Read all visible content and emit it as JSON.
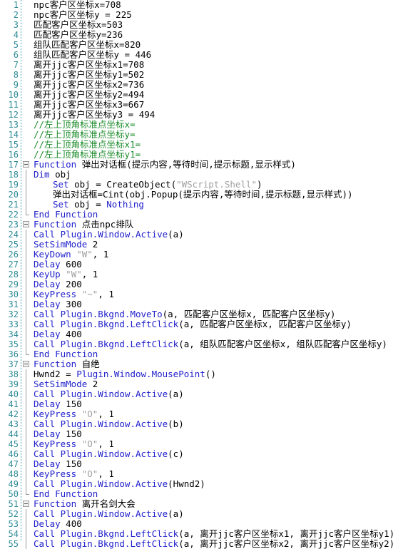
{
  "editor": {
    "name": "vbs-script-editor",
    "language": "VBScript / 按键精灵",
    "colors": {
      "background": "#ffffff",
      "line_number": "#2e8b96",
      "gutter_separator": "#4aa3b0",
      "keyword": "#2222cc",
      "comment": "#1b8b2a",
      "string": "#a0a0a0",
      "text": "#000000",
      "fold_marker": "#9a9a9a"
    },
    "first_visible_line": 1,
    "last_visible_line": 55,
    "total_visible_lines": 55
  },
  "lines": [
    {
      "n": 1,
      "fold": "none",
      "indent": 1,
      "tokens": [
        {
          "t": "plain",
          "s": "npc客户区坐标x=708"
        }
      ]
    },
    {
      "n": 2,
      "fold": "none",
      "indent": 1,
      "tokens": [
        {
          "t": "plain",
          "s": "npc客户区坐标y = 225"
        }
      ]
    },
    {
      "n": 3,
      "fold": "none",
      "indent": 1,
      "tokens": [
        {
          "t": "plain",
          "s": "匹配客户区坐标x=503"
        }
      ]
    },
    {
      "n": 4,
      "fold": "none",
      "indent": 1,
      "tokens": [
        {
          "t": "plain",
          "s": "匹配客户区坐标y=236"
        }
      ]
    },
    {
      "n": 5,
      "fold": "none",
      "indent": 1,
      "tokens": [
        {
          "t": "plain",
          "s": "组队匹配客户区坐标x=820"
        }
      ]
    },
    {
      "n": 6,
      "fold": "none",
      "indent": 1,
      "tokens": [
        {
          "t": "plain",
          "s": "组队匹配客户区坐标y = 446"
        }
      ]
    },
    {
      "n": 7,
      "fold": "none",
      "indent": 1,
      "tokens": [
        {
          "t": "plain",
          "s": "离开jjc客户区坐标x1=708"
        }
      ]
    },
    {
      "n": 8,
      "fold": "none",
      "indent": 1,
      "tokens": [
        {
          "t": "plain",
          "s": "离开jjc客户区坐标y1=502"
        }
      ]
    },
    {
      "n": 9,
      "fold": "none",
      "indent": 1,
      "tokens": [
        {
          "t": "plain",
          "s": "离开jjc客户区坐标x2=736"
        }
      ]
    },
    {
      "n": 10,
      "fold": "none",
      "indent": 1,
      "tokens": [
        {
          "t": "plain",
          "s": "离开jjc客户区坐标y2=494"
        }
      ]
    },
    {
      "n": 11,
      "fold": "none",
      "indent": 1,
      "tokens": [
        {
          "t": "plain",
          "s": "离开jjc客户区坐标x3=667"
        }
      ]
    },
    {
      "n": 12,
      "fold": "none",
      "indent": 1,
      "tokens": [
        {
          "t": "plain",
          "s": "离开jjc客户区坐标y3 = 494"
        }
      ]
    },
    {
      "n": 13,
      "fold": "none",
      "indent": 1,
      "tokens": [
        {
          "t": "cmt",
          "s": "//左上顶角标准点坐标x="
        }
      ]
    },
    {
      "n": 14,
      "fold": "none",
      "indent": 1,
      "tokens": [
        {
          "t": "cmt",
          "s": "//左上顶角标准点坐标y="
        }
      ]
    },
    {
      "n": 15,
      "fold": "none",
      "indent": 1,
      "tokens": [
        {
          "t": "cmt",
          "s": "//左上顶角标准点坐标x1="
        }
      ]
    },
    {
      "n": 16,
      "fold": "none",
      "indent": 1,
      "tokens": [
        {
          "t": "cmt",
          "s": "//左上顶角标准点坐标y1="
        }
      ]
    },
    {
      "n": 17,
      "fold": "start",
      "indent": 0,
      "tokens": [
        {
          "t": "kw",
          "s": "Function"
        },
        {
          "t": "plain",
          "s": " 弹出对话框(提示内容,等待时间,提示标题,显示样式)"
        }
      ]
    },
    {
      "n": 18,
      "fold": "mid",
      "indent": 0,
      "tokens": [
        {
          "t": "kw",
          "s": "Dim"
        },
        {
          "t": "plain",
          "s": " obj"
        }
      ]
    },
    {
      "n": 19,
      "fold": "mid",
      "indent": 2,
      "tokens": [
        {
          "t": "kw",
          "s": "Set"
        },
        {
          "t": "plain",
          "s": " obj = CreateObject("
        },
        {
          "t": "str",
          "s": "\"WScript.Shell\""
        },
        {
          "t": "plain",
          "s": ")"
        }
      ]
    },
    {
      "n": 20,
      "fold": "mid",
      "indent": 2,
      "tokens": [
        {
          "t": "plain",
          "s": "弹出对话框=Cint(obj.Popup(提示内容,等待时间,提示标题,显示样式))"
        }
      ]
    },
    {
      "n": 21,
      "fold": "mid",
      "indent": 2,
      "tokens": [
        {
          "t": "kw",
          "s": "Set"
        },
        {
          "t": "plain",
          "s": " obj = "
        },
        {
          "t": "kw",
          "s": "Nothing"
        }
      ]
    },
    {
      "n": 22,
      "fold": "end",
      "indent": 0,
      "tokens": [
        {
          "t": "kw",
          "s": "End Function"
        }
      ]
    },
    {
      "n": 23,
      "fold": "start",
      "indent": 0,
      "tokens": [
        {
          "t": "kw",
          "s": "Function"
        },
        {
          "t": "plain",
          "s": " 点击npc排队"
        }
      ]
    },
    {
      "n": 24,
      "fold": "mid",
      "indent": 0,
      "tokens": [
        {
          "t": "kw",
          "s": "Call Plugin.Window.Active"
        },
        {
          "t": "plain",
          "s": "(a)"
        }
      ]
    },
    {
      "n": 25,
      "fold": "mid",
      "indent": 0,
      "tokens": [
        {
          "t": "kw",
          "s": "SetSimMode"
        },
        {
          "t": "plain",
          "s": " 2"
        }
      ]
    },
    {
      "n": 26,
      "fold": "mid",
      "indent": 0,
      "tokens": [
        {
          "t": "kw",
          "s": "KeyDown"
        },
        {
          "t": "plain",
          "s": " "
        },
        {
          "t": "str",
          "s": "\"W\""
        },
        {
          "t": "plain",
          "s": ", 1"
        }
      ]
    },
    {
      "n": 27,
      "fold": "mid",
      "indent": 0,
      "tokens": [
        {
          "t": "kw",
          "s": "Delay"
        },
        {
          "t": "plain",
          "s": " 600"
        }
      ]
    },
    {
      "n": 28,
      "fold": "mid",
      "indent": 0,
      "tokens": [
        {
          "t": "kw",
          "s": "KeyUp"
        },
        {
          "t": "plain",
          "s": " "
        },
        {
          "t": "str",
          "s": "\"W\""
        },
        {
          "t": "plain",
          "s": ", 1"
        }
      ]
    },
    {
      "n": 29,
      "fold": "mid",
      "indent": 0,
      "tokens": [
        {
          "t": "kw",
          "s": "Delay"
        },
        {
          "t": "plain",
          "s": " 200"
        }
      ]
    },
    {
      "n": 30,
      "fold": "mid",
      "indent": 0,
      "tokens": [
        {
          "t": "kw",
          "s": "KeyPress"
        },
        {
          "t": "plain",
          "s": " "
        },
        {
          "t": "str",
          "s": "\"~\""
        },
        {
          "t": "plain",
          "s": ", 1"
        }
      ]
    },
    {
      "n": 31,
      "fold": "mid",
      "indent": 0,
      "tokens": [
        {
          "t": "kw",
          "s": "Delay"
        },
        {
          "t": "plain",
          "s": " 300"
        }
      ]
    },
    {
      "n": 32,
      "fold": "mid",
      "indent": 0,
      "tokens": [
        {
          "t": "kw",
          "s": "Call Plugin.Bkgnd.MoveTo"
        },
        {
          "t": "plain",
          "s": "(a, 匹配客户区坐标x, 匹配客户区坐标y)"
        }
      ]
    },
    {
      "n": 33,
      "fold": "mid",
      "indent": 0,
      "tokens": [
        {
          "t": "kw",
          "s": "Call Plugin.Bkgnd.LeftClick"
        },
        {
          "t": "plain",
          "s": "(a, 匹配客户区坐标x, 匹配客户区坐标y)"
        }
      ]
    },
    {
      "n": 34,
      "fold": "mid",
      "indent": 0,
      "tokens": [
        {
          "t": "kw",
          "s": "Delay"
        },
        {
          "t": "plain",
          "s": " 400"
        }
      ]
    },
    {
      "n": 35,
      "fold": "mid",
      "indent": 0,
      "tokens": [
        {
          "t": "kw",
          "s": "Call Plugin.Bkgnd.LeftClick"
        },
        {
          "t": "plain",
          "s": "(a, 组队匹配客户区坐标x, 组队匹配客户区坐标y)"
        }
      ]
    },
    {
      "n": 36,
      "fold": "end",
      "indent": 0,
      "tokens": [
        {
          "t": "kw",
          "s": "End Function"
        }
      ]
    },
    {
      "n": 37,
      "fold": "start",
      "indent": 0,
      "tokens": [
        {
          "t": "kw",
          "s": "Function"
        },
        {
          "t": "plain",
          "s": " 自绝"
        }
      ]
    },
    {
      "n": 38,
      "fold": "mid",
      "indent": 0,
      "tokens": [
        {
          "t": "plain",
          "s": "Hwnd2 = "
        },
        {
          "t": "kw",
          "s": "Plugin.Window.MousePoint"
        },
        {
          "t": "plain",
          "s": "()"
        }
      ]
    },
    {
      "n": 39,
      "fold": "mid",
      "indent": 0,
      "tokens": [
        {
          "t": "kw",
          "s": "SetSimMode"
        },
        {
          "t": "plain",
          "s": " 2"
        }
      ]
    },
    {
      "n": 40,
      "fold": "mid",
      "indent": 0,
      "tokens": [
        {
          "t": "kw",
          "s": "Call Plugin.Window.Active"
        },
        {
          "t": "plain",
          "s": "(a)"
        }
      ]
    },
    {
      "n": 41,
      "fold": "mid",
      "indent": 0,
      "tokens": [
        {
          "t": "kw",
          "s": "Delay"
        },
        {
          "t": "plain",
          "s": " 150"
        }
      ]
    },
    {
      "n": 42,
      "fold": "mid",
      "indent": 0,
      "tokens": [
        {
          "t": "kw",
          "s": "KeyPress"
        },
        {
          "t": "plain",
          "s": " "
        },
        {
          "t": "str",
          "s": "\"O\""
        },
        {
          "t": "plain",
          "s": ", 1"
        }
      ]
    },
    {
      "n": 43,
      "fold": "mid",
      "indent": 0,
      "tokens": [
        {
          "t": "kw",
          "s": "Call Plugin.Window.Active"
        },
        {
          "t": "plain",
          "s": "(b)"
        }
      ]
    },
    {
      "n": 44,
      "fold": "mid",
      "indent": 0,
      "tokens": [
        {
          "t": "kw",
          "s": "Delay"
        },
        {
          "t": "plain",
          "s": " 150"
        }
      ]
    },
    {
      "n": 45,
      "fold": "mid",
      "indent": 0,
      "tokens": [
        {
          "t": "kw",
          "s": "KeyPress"
        },
        {
          "t": "plain",
          "s": " "
        },
        {
          "t": "str",
          "s": "\"O\""
        },
        {
          "t": "plain",
          "s": ", 1"
        }
      ]
    },
    {
      "n": 46,
      "fold": "mid",
      "indent": 0,
      "tokens": [
        {
          "t": "kw",
          "s": "Call Plugin.Window.Active"
        },
        {
          "t": "plain",
          "s": "(c)"
        }
      ]
    },
    {
      "n": 47,
      "fold": "mid",
      "indent": 0,
      "tokens": [
        {
          "t": "kw",
          "s": "Delay"
        },
        {
          "t": "plain",
          "s": " 150"
        }
      ]
    },
    {
      "n": 48,
      "fold": "mid",
      "indent": 0,
      "tokens": [
        {
          "t": "kw",
          "s": "KeyPress"
        },
        {
          "t": "plain",
          "s": " "
        },
        {
          "t": "str",
          "s": "\"O\""
        },
        {
          "t": "plain",
          "s": ", 1"
        }
      ]
    },
    {
      "n": 49,
      "fold": "mid",
      "indent": 0,
      "tokens": [
        {
          "t": "kw",
          "s": "Call Plugin.Window.Active"
        },
        {
          "t": "plain",
          "s": "(Hwnd2)"
        }
      ]
    },
    {
      "n": 50,
      "fold": "end",
      "indent": 0,
      "tokens": [
        {
          "t": "kw",
          "s": "End Function"
        }
      ]
    },
    {
      "n": 51,
      "fold": "start",
      "indent": 0,
      "tokens": [
        {
          "t": "kw",
          "s": "Function"
        },
        {
          "t": "plain",
          "s": " 离开名剑大会"
        }
      ]
    },
    {
      "n": 52,
      "fold": "mid",
      "indent": 0,
      "tokens": [
        {
          "t": "kw",
          "s": "Call Plugin.Window.Active"
        },
        {
          "t": "plain",
          "s": "(a)"
        }
      ]
    },
    {
      "n": 53,
      "fold": "mid",
      "indent": 0,
      "tokens": [
        {
          "t": "kw",
          "s": "Delay"
        },
        {
          "t": "plain",
          "s": " 400"
        }
      ]
    },
    {
      "n": 54,
      "fold": "mid",
      "indent": 0,
      "tokens": [
        {
          "t": "kw",
          "s": "Call Plugin.Bkgnd.LeftClick"
        },
        {
          "t": "plain",
          "s": "(a, 离开jjc客户区坐标x1, 离开jjc客户区坐标y1)"
        }
      ]
    },
    {
      "n": 55,
      "fold": "mid",
      "indent": 0,
      "tokens": [
        {
          "t": "kw",
          "s": "Call Plugin.Bkgnd.LeftClick"
        },
        {
          "t": "plain",
          "s": "(a, 离开jjc客户区坐标x2, 离开jjc客户区坐标y2)"
        }
      ]
    }
  ]
}
